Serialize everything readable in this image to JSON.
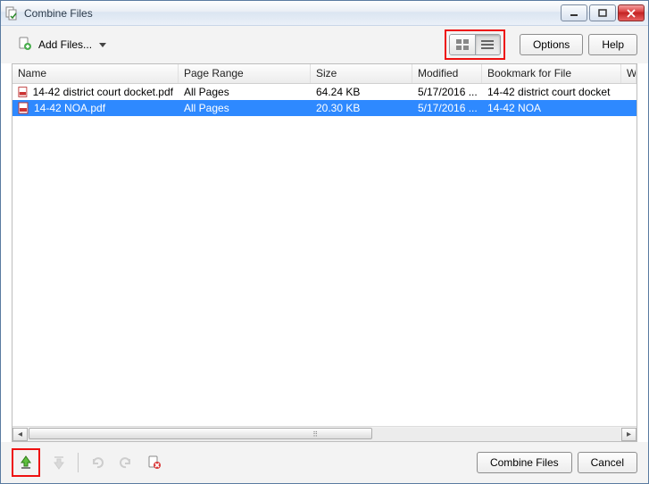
{
  "window": {
    "title": "Combine Files"
  },
  "toolbar": {
    "add_files_label": "Add Files...",
    "options_label": "Options",
    "help_label": "Help"
  },
  "columns": {
    "name": "Name",
    "range": "Page Range",
    "size": "Size",
    "modified": "Modified",
    "bookmark": "Bookmark for File",
    "warnings": "Warnings"
  },
  "rows": [
    {
      "name": "14-42 district court docket.pdf",
      "range": "All Pages",
      "size": "64.24 KB",
      "modified": "5/17/2016 ...",
      "bookmark": "14-42 district court docket",
      "selected": false
    },
    {
      "name": "14-42 NOA.pdf",
      "range": "All Pages",
      "size": "20.30 KB",
      "modified": "5/17/2016 ...",
      "bookmark": "14-42 NOA",
      "selected": true
    }
  ],
  "footer": {
    "combine_label": "Combine Files",
    "cancel_label": "Cancel"
  }
}
